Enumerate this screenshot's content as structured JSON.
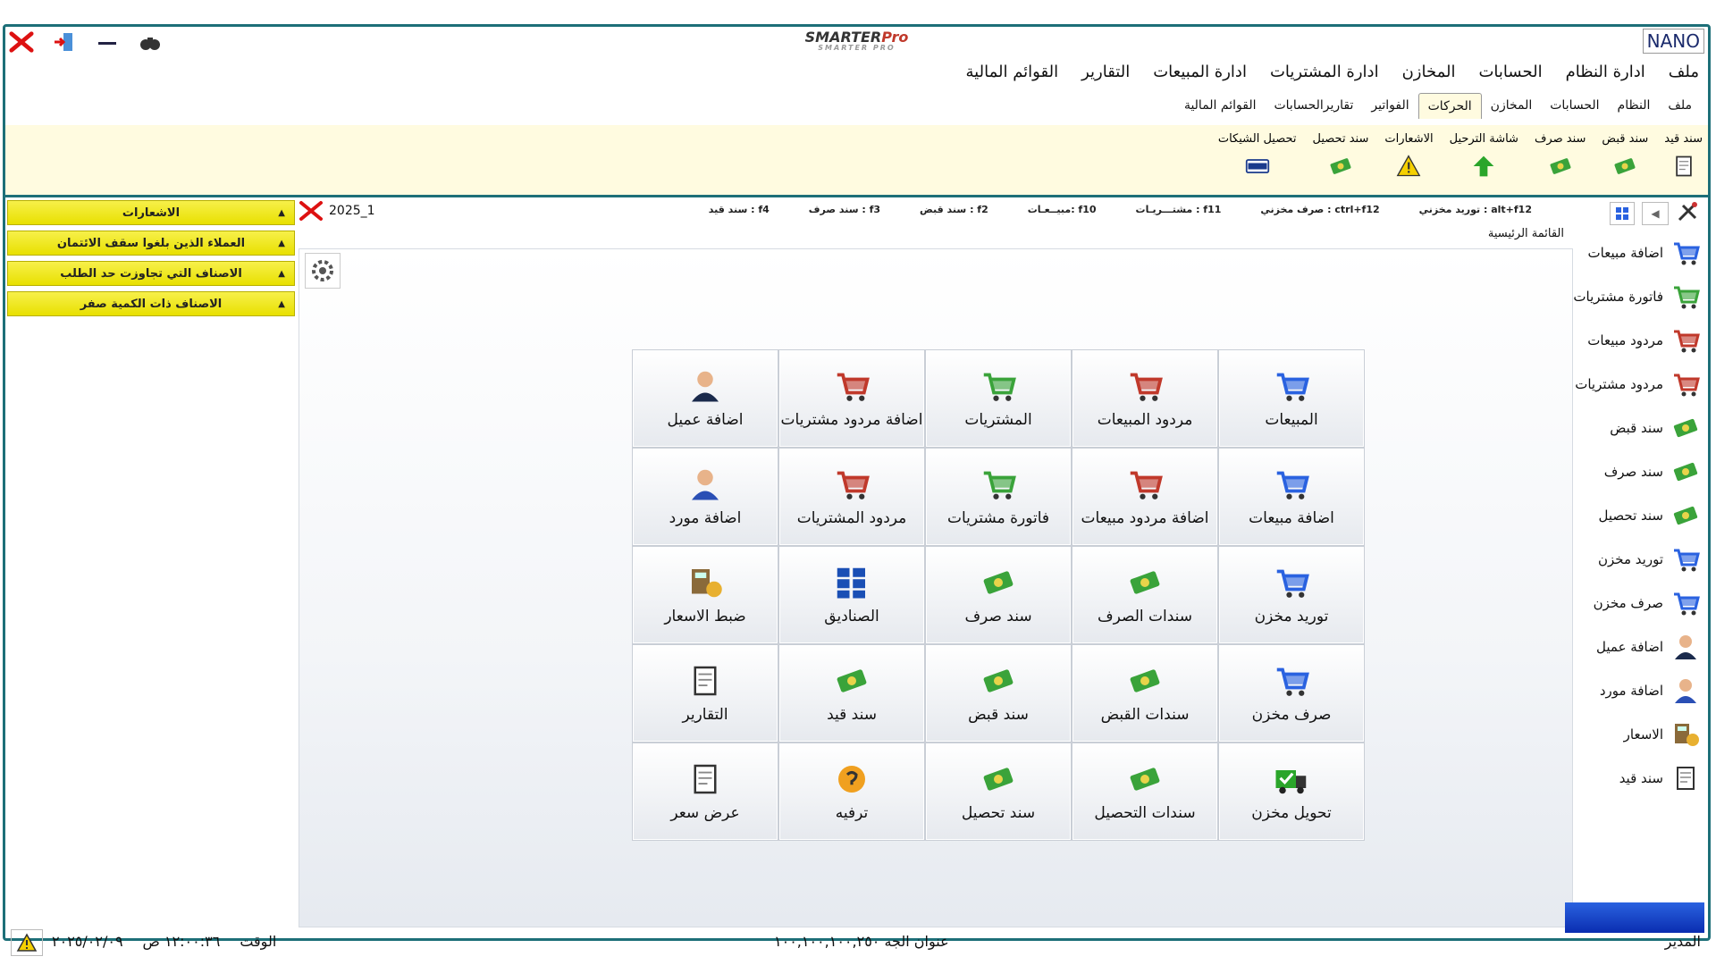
{
  "window": {
    "app_name_main": "SMARTER",
    "app_name_accent": "Pro",
    "app_subtitle": "SMARTER PRO",
    "brand_badge": "NANO"
  },
  "menu": [
    "ملف",
    "ادارة النظام",
    "الحسابات",
    "المخازن",
    "ادارة المشتريات",
    "ادارة المبيعات",
    "التقارير",
    "القوائم المالية"
  ],
  "tabs": [
    {
      "label": "ملف",
      "active": false
    },
    {
      "label": "النظام",
      "active": false
    },
    {
      "label": "الحسابات",
      "active": false
    },
    {
      "label": "المخازن",
      "active": false
    },
    {
      "label": "الحركات",
      "active": true
    },
    {
      "label": "الفواتير",
      "active": false
    },
    {
      "label": "تقاريرالحسابات",
      "active": false
    },
    {
      "label": "القوائم المالية",
      "active": false
    }
  ],
  "ribbon": [
    {
      "label": "سند قيد",
      "icon": "journal-icon"
    },
    {
      "label": "سند قبض",
      "icon": "receipt-icon"
    },
    {
      "label": "سند صرف",
      "icon": "payment-icon"
    },
    {
      "label": "شاشة الترحيل",
      "icon": "posting-icon"
    },
    {
      "label": "الاشعارات",
      "icon": "warning-icon"
    },
    {
      "label": "سند تحصيل",
      "icon": "collection-icon"
    },
    {
      "label": "تحصيل الشيكات",
      "icon": "visa-card-icon"
    }
  ],
  "alerts": [
    {
      "label": "الاشعارات"
    },
    {
      "label": "العملاء الذين بلغوا سقف الائتمان"
    },
    {
      "label": "الاصناف التي تجاوزت حد الطلب"
    },
    {
      "label": "الاصناف ذات الكمية صفر"
    }
  ],
  "info": {
    "year": "2025_1",
    "shortcuts": [
      "توريد مخزني : alt+f12",
      "صرف مخزني : ctrl+f12",
      "مشتـــريـات : f11",
      "مبيــعـات: f10",
      "سند قبض : f2",
      "سند صرف : f3",
      "سند قيد : f4"
    ],
    "main_menu_label": "القائمة الرئيسية"
  },
  "tiles": [
    {
      "label": "المبيعات",
      "icon": "sales-basket-icon"
    },
    {
      "label": "مردود المبيعات",
      "icon": "sales-return-cart-icon"
    },
    {
      "label": "المشتريات",
      "icon": "purchases-cart-icon"
    },
    {
      "label": "اضافة مردود مشتريات",
      "icon": "add-purchase-return-icon"
    },
    {
      "label": "اضافة عميل",
      "icon": "customer-icon"
    },
    {
      "label": "اضافة مبيعات",
      "icon": "add-sales-cart-icon"
    },
    {
      "label": "اضافة مردود مبيعات",
      "icon": "add-sales-return-icon"
    },
    {
      "label": "فاتورة مشتريات",
      "icon": "purchase-invoice-icon"
    },
    {
      "label": "مردود المشتريات",
      "icon": "purchase-return-icon"
    },
    {
      "label": "اضافة مورد",
      "icon": "supplier-icon"
    },
    {
      "label": "توريد مخزن",
      "icon": "stock-in-cart-icon"
    },
    {
      "label": "سندات الصرف",
      "icon": "payment-vouchers-icon"
    },
    {
      "label": "سند صرف",
      "icon": "payment-voucher-icon"
    },
    {
      "label": "الصناديق",
      "icon": "cashboxes-icon"
    },
    {
      "label": "ضبط الاسعار",
      "icon": "price-adjust-icon"
    },
    {
      "label": "صرف مخزن",
      "icon": "stock-out-cart-icon"
    },
    {
      "label": "سندات القبض",
      "icon": "receipt-vouchers-icon"
    },
    {
      "label": "سند قبض",
      "icon": "receipt-voucher-icon"
    },
    {
      "label": "سند قيد",
      "icon": "journal-voucher-icon"
    },
    {
      "label": "التقارير",
      "icon": "reports-icon"
    },
    {
      "label": "تحويل مخزن",
      "icon": "stock-transfer-truck-icon"
    },
    {
      "label": "سندات التحصيل",
      "icon": "collection-vouchers-icon"
    },
    {
      "label": "سند تحصيل",
      "icon": "collection-voucher-icon"
    },
    {
      "label": "ترفيه",
      "icon": "entertainment-icon"
    },
    {
      "label": "عرض سعر",
      "icon": "quotation-icon"
    }
  ],
  "sidebar": [
    {
      "label": "اضافة مبيعات",
      "icon": "add-sales-cart-icon"
    },
    {
      "label": "فاتورة مشتريات",
      "icon": "purchase-cart-icon"
    },
    {
      "label": "مردود مبيعات",
      "icon": "sales-return-icon"
    },
    {
      "label": "مردود مشتريات",
      "icon": "purchase-return-icon"
    },
    {
      "label": "سند قبض",
      "icon": "receipt-icon"
    },
    {
      "label": "سند صرف",
      "icon": "payment-icon"
    },
    {
      "label": "سند تحصيل",
      "icon": "collection-icon"
    },
    {
      "label": "توريد مخزن",
      "icon": "stock-in-icon"
    },
    {
      "label": "صرف مخزن",
      "icon": "stock-out-icon"
    },
    {
      "label": "اضافة عميل",
      "icon": "customer-icon"
    },
    {
      "label": "اضافة مورد",
      "icon": "supplier-icon"
    },
    {
      "label": "الاسعار",
      "icon": "prices-icon"
    },
    {
      "label": "سند قيد",
      "icon": "journal-icon"
    }
  ],
  "status": {
    "time_label": "الوقت",
    "time_value": "١٢:٠٠:٣٦ ص",
    "date_value": "٢٠٢٥/٠٢/٠٩",
    "address": "عنوان الجه ١٠٠,١٠٠,١٠٠,٢٥٠",
    "user": "المدير"
  },
  "colors": {
    "frame": "#1d6f78",
    "ribbon_bg": "#fffbe0",
    "alert_yellow": "#f0e820",
    "accent_blue": "#0a2db0"
  }
}
